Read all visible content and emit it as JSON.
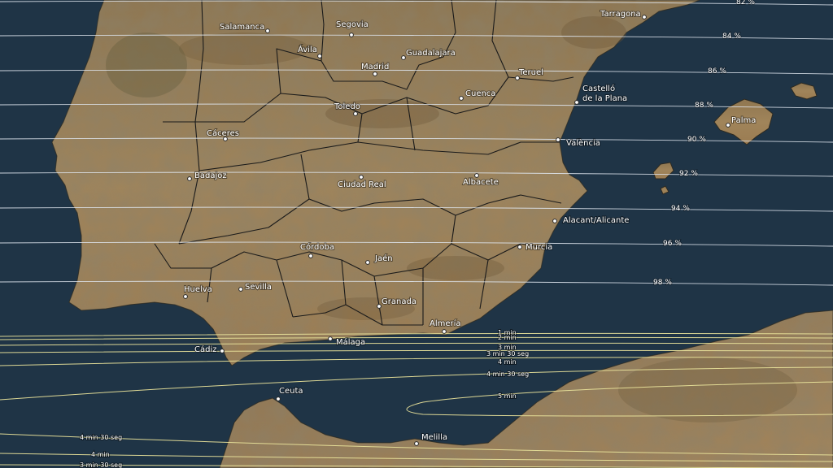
{
  "colors": {
    "sea": "#1f3446",
    "land": "#9a7f57",
    "land_dark": "#6f5a3c",
    "magnitude_line": "#dfe6ee",
    "duration_line": "#e8e29a",
    "border": "#1a1a1a"
  },
  "magnitude_lines": [
    {
      "label": "82 %"
    },
    {
      "label": "84 %"
    },
    {
      "label": "86 %"
    },
    {
      "label": "88 %"
    },
    {
      "label": "90 %"
    },
    {
      "label": "92 %"
    },
    {
      "label": "94 %"
    },
    {
      "label": "96 %"
    },
    {
      "label": "98 %"
    }
  ],
  "duration_lines": [
    {
      "label": "1 min"
    },
    {
      "label": "2 min"
    },
    {
      "label": "3 min"
    },
    {
      "label": "3 min 30 seg"
    },
    {
      "label": "4 min"
    },
    {
      "label": "4 min 30 seg"
    },
    {
      "label": "5 min"
    },
    {
      "label": "4 min 30 seg"
    },
    {
      "label": "4 min"
    },
    {
      "label": "3 min 30 seg"
    }
  ],
  "cities": [
    {
      "name": "Salamanca"
    },
    {
      "name": "Segovia"
    },
    {
      "name": "Ávila"
    },
    {
      "name": "Madrid"
    },
    {
      "name": "Guadalajara"
    },
    {
      "name": "Tarragona"
    },
    {
      "name": "Teruel"
    },
    {
      "name": "Cuenca"
    },
    {
      "name": "Castelló de la Plana"
    },
    {
      "name": "Toledo"
    },
    {
      "name": "Palma"
    },
    {
      "name": "Cáceres"
    },
    {
      "name": "València"
    },
    {
      "name": "Badajoz"
    },
    {
      "name": "Ciudad Real"
    },
    {
      "name": "Albacete"
    },
    {
      "name": "Alacant/Alicante"
    },
    {
      "name": "Córdoba"
    },
    {
      "name": "Murcia"
    },
    {
      "name": "Jaén"
    },
    {
      "name": "Huelva"
    },
    {
      "name": "Sevilla"
    },
    {
      "name": "Granada"
    },
    {
      "name": "Almería"
    },
    {
      "name": "Cádiz"
    },
    {
      "name": "Málaga"
    },
    {
      "name": "Ceuta"
    },
    {
      "name": "Melilla"
    }
  ]
}
